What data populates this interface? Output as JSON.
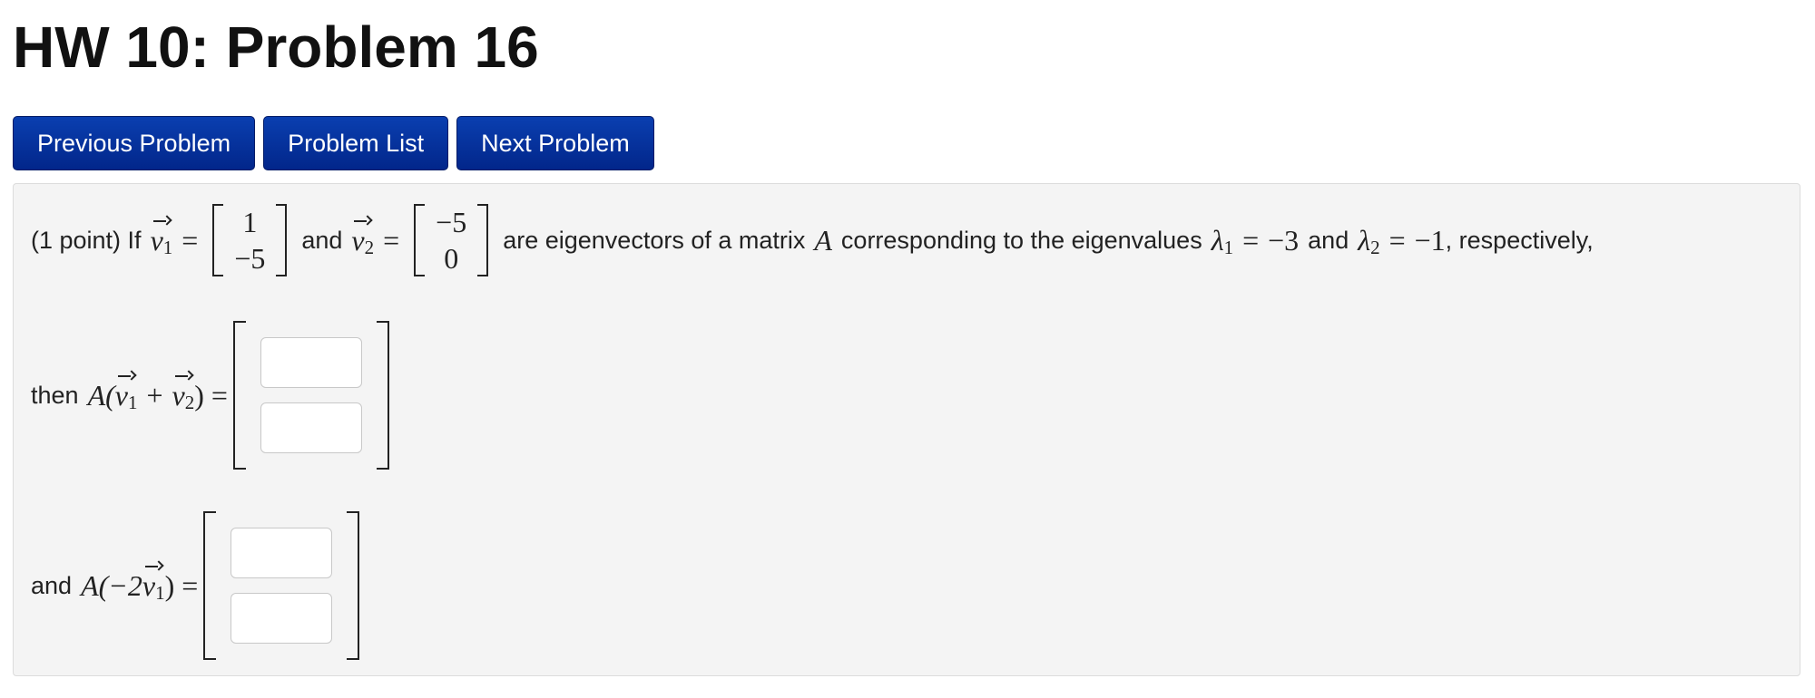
{
  "page_title": "HW 10: Problem 16",
  "nav": {
    "previous_label": "Previous Problem",
    "list_label": "Problem List",
    "next_label": "Next Problem"
  },
  "problem": {
    "points_prefix": "(1 point) If",
    "v1_name": "v",
    "v1_sub": "1",
    "v1_entries": [
      "1",
      "−5"
    ],
    "and_text": "and",
    "v2_name": "v",
    "v2_sub": "2",
    "v2_entries": [
      "−5",
      "0"
    ],
    "mid_text": "are eigenvectors of a matrix",
    "matrix_name": "A",
    "corr_text": "corresponding to the eigenvalues",
    "lambda1_name": "λ",
    "lambda1_sub": "1",
    "lambda1_value": "−3",
    "and_text2": "and",
    "lambda2_name": "λ",
    "lambda2_sub": "2",
    "lambda2_value": "−1",
    "tail_text": ", respectively,",
    "q1_prefix": "then",
    "q1_expr_left": "A(",
    "q1_plus": "+",
    "q1_expr_right": ") =",
    "q2_prefix": "and",
    "q2_expr_left": "A(−2",
    "q2_expr_right": ") =",
    "answers": {
      "q1_top": "",
      "q1_bottom": "",
      "q2_top": "",
      "q2_bottom": ""
    }
  }
}
